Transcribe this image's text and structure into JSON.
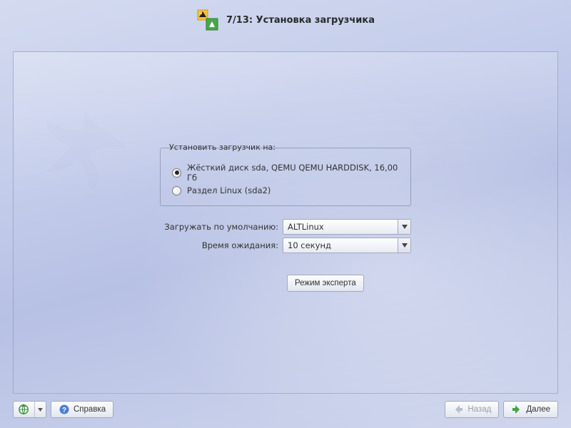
{
  "header": {
    "title": "7/13: Установка загрузчика"
  },
  "group": {
    "title": "Установить загрузчик на:",
    "options": [
      {
        "label": "Жёсткий диск sda, QEMU QEMU HARDDISK, 16,00 Гб",
        "checked": true
      },
      {
        "label": "Раздел Linux (sda2)",
        "checked": false
      }
    ]
  },
  "fields": {
    "default_label": "Загружать по умолчанию:",
    "default_value": "ALTLinux",
    "timeout_label": "Время ожидания:",
    "timeout_value": "10 секунд"
  },
  "expert_button": "Режим эксперта",
  "footer": {
    "help": "Справка",
    "back": "Назад",
    "next": "Далее"
  }
}
